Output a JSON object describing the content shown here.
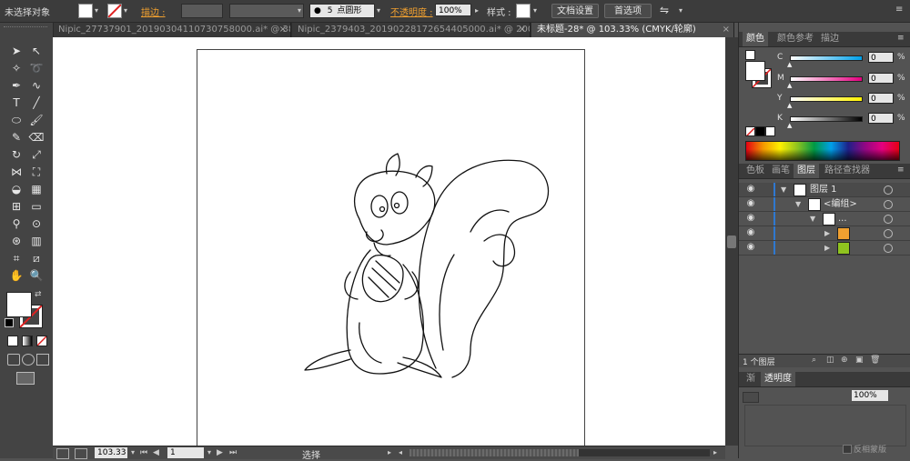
{
  "control_bar": {
    "selection_status": "未选择对象",
    "stroke_label": "描边 :",
    "brush_size": "5",
    "brush_shape": "点圆形",
    "opacity_label": "不透明度 :",
    "opacity_value": "100%",
    "style_label": "样式 :",
    "doc_setup_button": "文档设置",
    "preferences_button": "首选项"
  },
  "tabs": [
    {
      "label": "Nipic_27737901_20190304110730758000.ai* @ 38...",
      "close": "×"
    },
    {
      "label": "Nipic_2379403_20190228172654405000.ai* @ 200...",
      "close": "×"
    },
    {
      "label": "未标题-28* @ 103.33% (CMYK/轮廓)",
      "close": "×"
    }
  ],
  "color_panel": {
    "tabs": [
      "颜色",
      "颜色参考",
      "描边"
    ],
    "sliders": [
      {
        "label": "C",
        "value": "0",
        "unit": "%"
      },
      {
        "label": "M",
        "value": "0",
        "unit": "%"
      },
      {
        "label": "Y",
        "value": "0",
        "unit": "%"
      },
      {
        "label": "K",
        "value": "0",
        "unit": "%"
      }
    ]
  },
  "layers_panel": {
    "tabs": [
      "色板",
      "画笔",
      "图层",
      "路径查找器"
    ],
    "rows": [
      {
        "label": "图层 1",
        "indent": 0
      },
      {
        "label": "<编组>",
        "indent": 1
      },
      {
        "label": "...",
        "indent": 2
      },
      {
        "label": "",
        "indent": 3
      },
      {
        "label": "",
        "indent": 3
      }
    ],
    "footer_count": "1 个图层"
  },
  "transparency_panel": {
    "tabs": [
      "渐",
      "透明度"
    ],
    "opacity": "100%",
    "invert_mask_label": "反相蒙版"
  },
  "status_bar": {
    "zoom": "103.33",
    "artboard_number": "1",
    "tool_status": "选择"
  },
  "colors": {
    "workspace": "#535353",
    "canvas": "#ffffff",
    "accent_orange": "#f0a030"
  }
}
